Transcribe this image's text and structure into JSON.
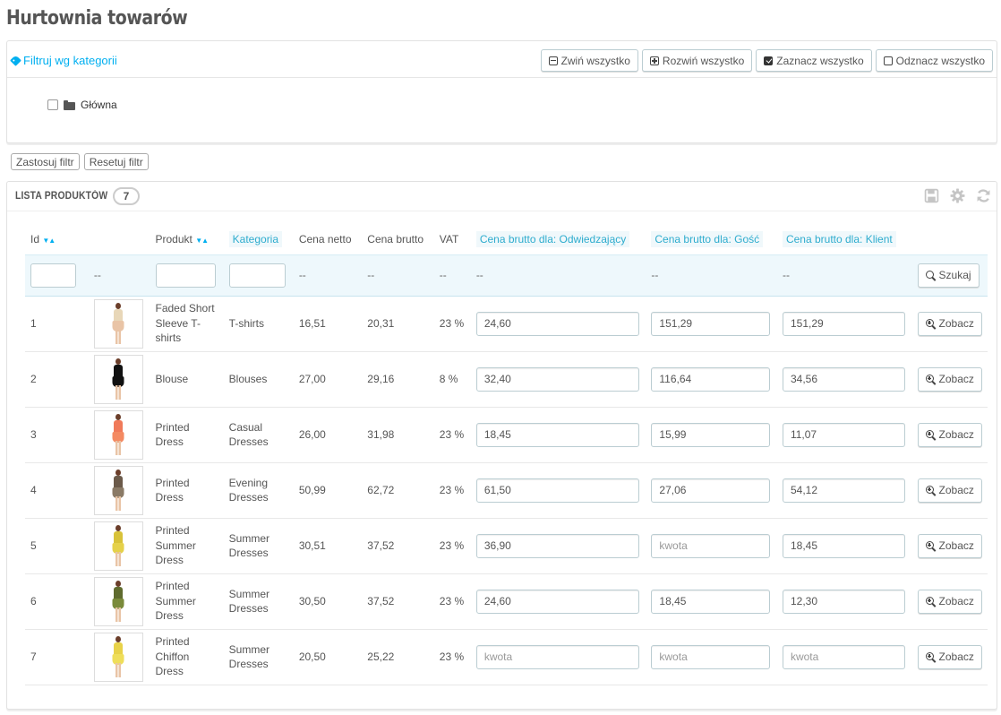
{
  "page": {
    "title": "Hurtownia towarów"
  },
  "filter": {
    "title": "Filtruj wg kategorii",
    "collapse_all": "Zwiń wszystko",
    "expand_all": "Rozwiń wszystko",
    "check_all": "Zaznacz wszystko",
    "uncheck_all": "Odznacz wszystko",
    "tree_root": "Główna",
    "apply": "Zastosuj filtr",
    "reset": "Resetuj filtr"
  },
  "products": {
    "title": "Lista produktów",
    "count": "7",
    "columns": {
      "id": "Id",
      "product": "Produkt",
      "category": "Kategoria",
      "net": "Cena netto",
      "gross": "Cena brutto",
      "vat": "VAT",
      "visitor": "Cena brutto dla: Odwiedzający",
      "guest": "Cena brutto dla: Gość",
      "client": "Cena brutto dla: Klient"
    },
    "filter_row": {
      "dash": "--",
      "search": "Szukaj"
    },
    "view_label": "Zobacz",
    "placeholder": "kwota",
    "rows": [
      {
        "id": "1",
        "product": "Faded Short Sleeve T-shirts",
        "category": "T-shirts",
        "net": "16,51",
        "gross": "20,31",
        "vat": "23 %",
        "visitor": "24,60",
        "guest": "151,29",
        "client": "151,29"
      },
      {
        "id": "2",
        "product": "Blouse",
        "category": "Blouses",
        "net": "27,00",
        "gross": "29,16",
        "vat": "8 %",
        "visitor": "32,40",
        "guest": "116,64",
        "client": "34,56"
      },
      {
        "id": "3",
        "product": "Printed Dress",
        "category": "Casual Dresses",
        "net": "26,00",
        "gross": "31,98",
        "vat": "23 %",
        "visitor": "18,45",
        "guest": "15,99",
        "client": "11,07"
      },
      {
        "id": "4",
        "product": "Printed Dress",
        "category": "Evening Dresses",
        "net": "50,99",
        "gross": "62,72",
        "vat": "23 %",
        "visitor": "61,50",
        "guest": "27,06",
        "client": "54,12"
      },
      {
        "id": "5",
        "product": "Printed Summer Dress",
        "category": "Summer Dresses",
        "net": "30,51",
        "gross": "37,52",
        "vat": "23 %",
        "visitor": "36,90",
        "guest": "",
        "client": "18,45"
      },
      {
        "id": "6",
        "product": "Printed Summer Dress",
        "category": "Summer Dresses",
        "net": "30,50",
        "gross": "37,52",
        "vat": "23 %",
        "visitor": "24,60",
        "guest": "18,45",
        "client": "12,30"
      },
      {
        "id": "7",
        "product": "Printed Chiffon Dress",
        "category": "Summer Dresses",
        "net": "20,50",
        "gross": "25,22",
        "vat": "23 %",
        "visitor": "",
        "guest": "",
        "client": ""
      }
    ]
  },
  "icons": {
    "filter_title": "tag-icon",
    "tree_root": "folder-icon",
    "search": "search-icon",
    "view": "zoom-in-icon",
    "tools": [
      "save-icon",
      "gear-icon",
      "refresh-icon"
    ]
  },
  "colors": {
    "accent": "#00aff0",
    "header_highlight": "#2eacce",
    "filter_row_bg": "#eef8fc"
  }
}
